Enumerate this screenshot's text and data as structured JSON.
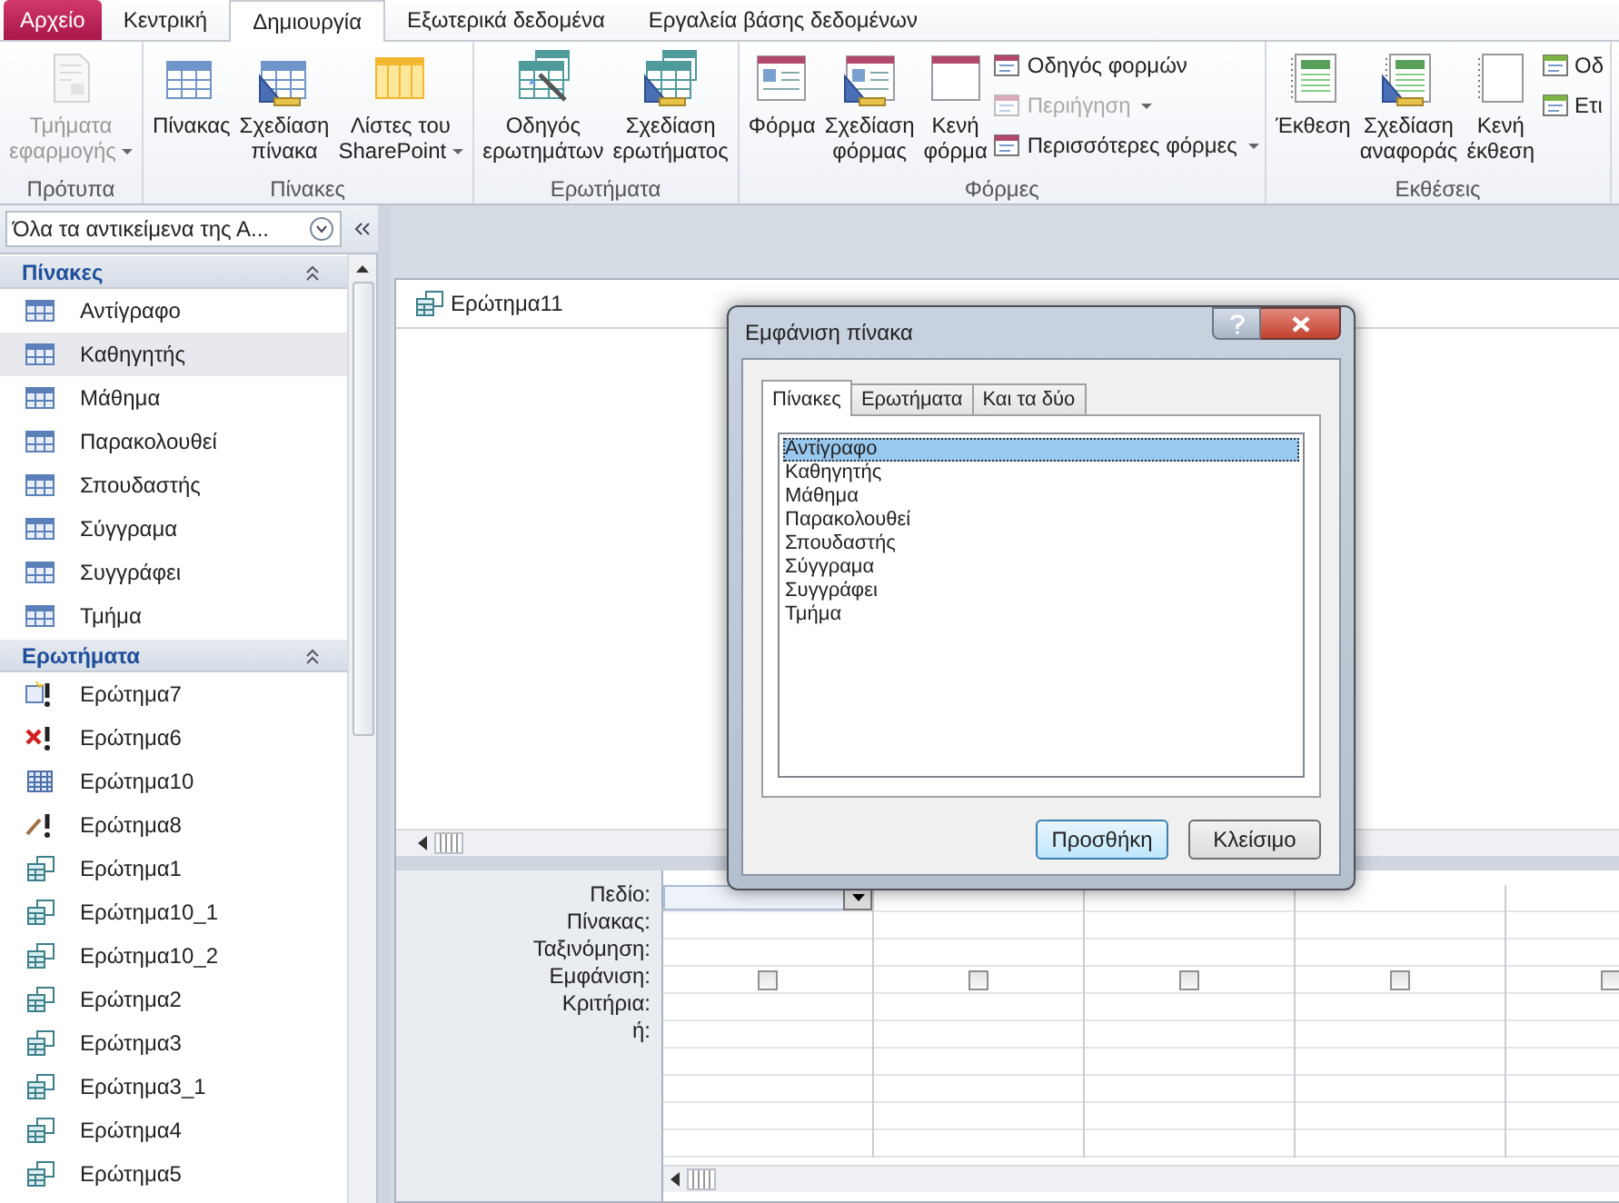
{
  "ribbon": {
    "tabs": [
      {
        "label": "Αρχείο",
        "kind": "file",
        "selected": false
      },
      {
        "label": "Κεντρική",
        "kind": "tab",
        "selected": false
      },
      {
        "label": "Δημιουργία",
        "kind": "tab",
        "selected": true
      },
      {
        "label": "Εξωτερικά δεδομένα",
        "kind": "tab",
        "selected": false
      },
      {
        "label": "Εργαλεία βάσης δεδομένων",
        "kind": "tab",
        "selected": false
      }
    ],
    "groups": [
      {
        "title": "Πρότυπα",
        "buttons": [
          {
            "lines": [
              "Τμήματα",
              "εφαρμογής"
            ],
            "dropdown": true,
            "disabled": true
          }
        ]
      },
      {
        "title": "Πίνακες",
        "buttons": [
          {
            "lines": [
              "Πίνακας"
            ],
            "dropdown": false,
            "disabled": false
          },
          {
            "lines": [
              "Σχεδίαση",
              "πίνακα"
            ],
            "dropdown": false,
            "disabled": false
          },
          {
            "lines": [
              "Λίστες του",
              "SharePoint"
            ],
            "dropdown": true,
            "disabled": false
          }
        ]
      },
      {
        "title": "Ερωτήματα",
        "buttons": [
          {
            "lines": [
              "Οδηγός",
              "ερωτημάτων"
            ],
            "dropdown": false,
            "disabled": false
          },
          {
            "lines": [
              "Σχεδίαση",
              "ερωτήματος"
            ],
            "dropdown": false,
            "disabled": false
          }
        ]
      },
      {
        "title": "Φόρμες",
        "buttons": [
          {
            "lines": [
              "Φόρμα"
            ],
            "dropdown": false,
            "disabled": false
          },
          {
            "lines": [
              "Σχεδίαση",
              "φόρμας"
            ],
            "dropdown": false,
            "disabled": false
          },
          {
            "lines": [
              "Κενή",
              "φόρμα"
            ],
            "dropdown": false,
            "disabled": false
          }
        ],
        "small": [
          {
            "label": "Οδηγός φορμών",
            "dropdown": false,
            "disabled": false
          },
          {
            "label": "Περιήγηση",
            "dropdown": true,
            "disabled": true
          },
          {
            "label": "Περισσότερες φόρμες",
            "dropdown": true,
            "disabled": false
          }
        ]
      },
      {
        "title": "Εκθέσεις",
        "buttons": [
          {
            "lines": [
              "Έκθεση"
            ],
            "dropdown": false,
            "disabled": false
          },
          {
            "lines": [
              "Σχεδίαση",
              "αναφοράς"
            ],
            "dropdown": false,
            "disabled": false
          },
          {
            "lines": [
              "Κενή",
              "έκθεση"
            ],
            "dropdown": false,
            "disabled": false
          }
        ],
        "small": [
          {
            "label": "Οδ",
            "dropdown": false,
            "disabled": false
          },
          {
            "label": "Ετι",
            "dropdown": false,
            "disabled": false
          }
        ]
      }
    ]
  },
  "navigation": {
    "title": "Όλα τα αντικείμενα της Α...",
    "sections": [
      {
        "title": "Πίνακες",
        "expanded": true,
        "items": [
          {
            "label": "Αντίγραφο",
            "kind": "table",
            "selected": false
          },
          {
            "label": "Καθηγητής",
            "kind": "table",
            "selected": true
          },
          {
            "label": "Μάθημα",
            "kind": "table",
            "selected": false
          },
          {
            "label": "Παρακολουθεί",
            "kind": "table",
            "selected": false
          },
          {
            "label": "Σπουδαστής",
            "kind": "table",
            "selected": false
          },
          {
            "label": "Σύγγραμα",
            "kind": "table",
            "selected": false
          },
          {
            "label": "Συγγράφει",
            "kind": "table",
            "selected": false
          },
          {
            "label": "Τμήμα",
            "kind": "table",
            "selected": false
          }
        ]
      },
      {
        "title": "Ερωτήματα",
        "expanded": true,
        "items": [
          {
            "label": "Ερώτημα7",
            "kind": "make_table",
            "selected": false
          },
          {
            "label": "Ερώτημα6",
            "kind": "delete",
            "selected": false
          },
          {
            "label": "Ερώτημα10",
            "kind": "crosstab",
            "selected": false
          },
          {
            "label": "Ερώτημα8",
            "kind": "update",
            "selected": false
          },
          {
            "label": "Ερώτημα1",
            "kind": "select",
            "selected": false
          },
          {
            "label": "Ερώτημα10_1",
            "kind": "select",
            "selected": false
          },
          {
            "label": "Ερώτημα10_2",
            "kind": "select",
            "selected": false
          },
          {
            "label": "Ερώτημα2",
            "kind": "select",
            "selected": false
          },
          {
            "label": "Ερώτημα3",
            "kind": "select",
            "selected": false
          },
          {
            "label": "Ερώτημα3_1",
            "kind": "select",
            "selected": false
          },
          {
            "label": "Ερώτημα4",
            "kind": "select",
            "selected": false
          },
          {
            "label": "Ερώτημα5",
            "kind": "select",
            "selected": false
          }
        ]
      }
    ]
  },
  "query_window": {
    "title": "Ερώτημα11",
    "grid": {
      "row_labels": [
        "Πεδίο:",
        "Πίνακας:",
        "Ταξινόμηση:",
        "Εμφάνιση:",
        "Κριτήρια:",
        "ή:"
      ],
      "columns": [
        {
          "show": false,
          "active": true
        },
        {
          "show": false,
          "active": false
        },
        {
          "show": false,
          "active": false
        },
        {
          "show": false,
          "active": false
        },
        {
          "show": false,
          "active": false
        }
      ]
    }
  },
  "dialog": {
    "title": "Εμφάνιση πίνακα",
    "tabs": [
      {
        "label": "Πίνακες",
        "selected": true
      },
      {
        "label": "Ερωτήματα",
        "selected": false
      },
      {
        "label": "Και τα δύο",
        "selected": false
      }
    ],
    "items": [
      {
        "label": "Αντίγραφο",
        "selected": true
      },
      {
        "label": "Καθηγητής",
        "selected": false
      },
      {
        "label": "Μάθημα",
        "selected": false
      },
      {
        "label": "Παρακολουθεί",
        "selected": false
      },
      {
        "label": "Σπουδαστής",
        "selected": false
      },
      {
        "label": "Σύγγραμα",
        "selected": false
      },
      {
        "label": "Συγγράφει",
        "selected": false
      },
      {
        "label": "Τμήμα",
        "selected": false
      }
    ],
    "buttons": [
      {
        "label": "Προσθήκη",
        "default": true
      },
      {
        "label": "Κλείσιμο",
        "default": false
      }
    ]
  }
}
